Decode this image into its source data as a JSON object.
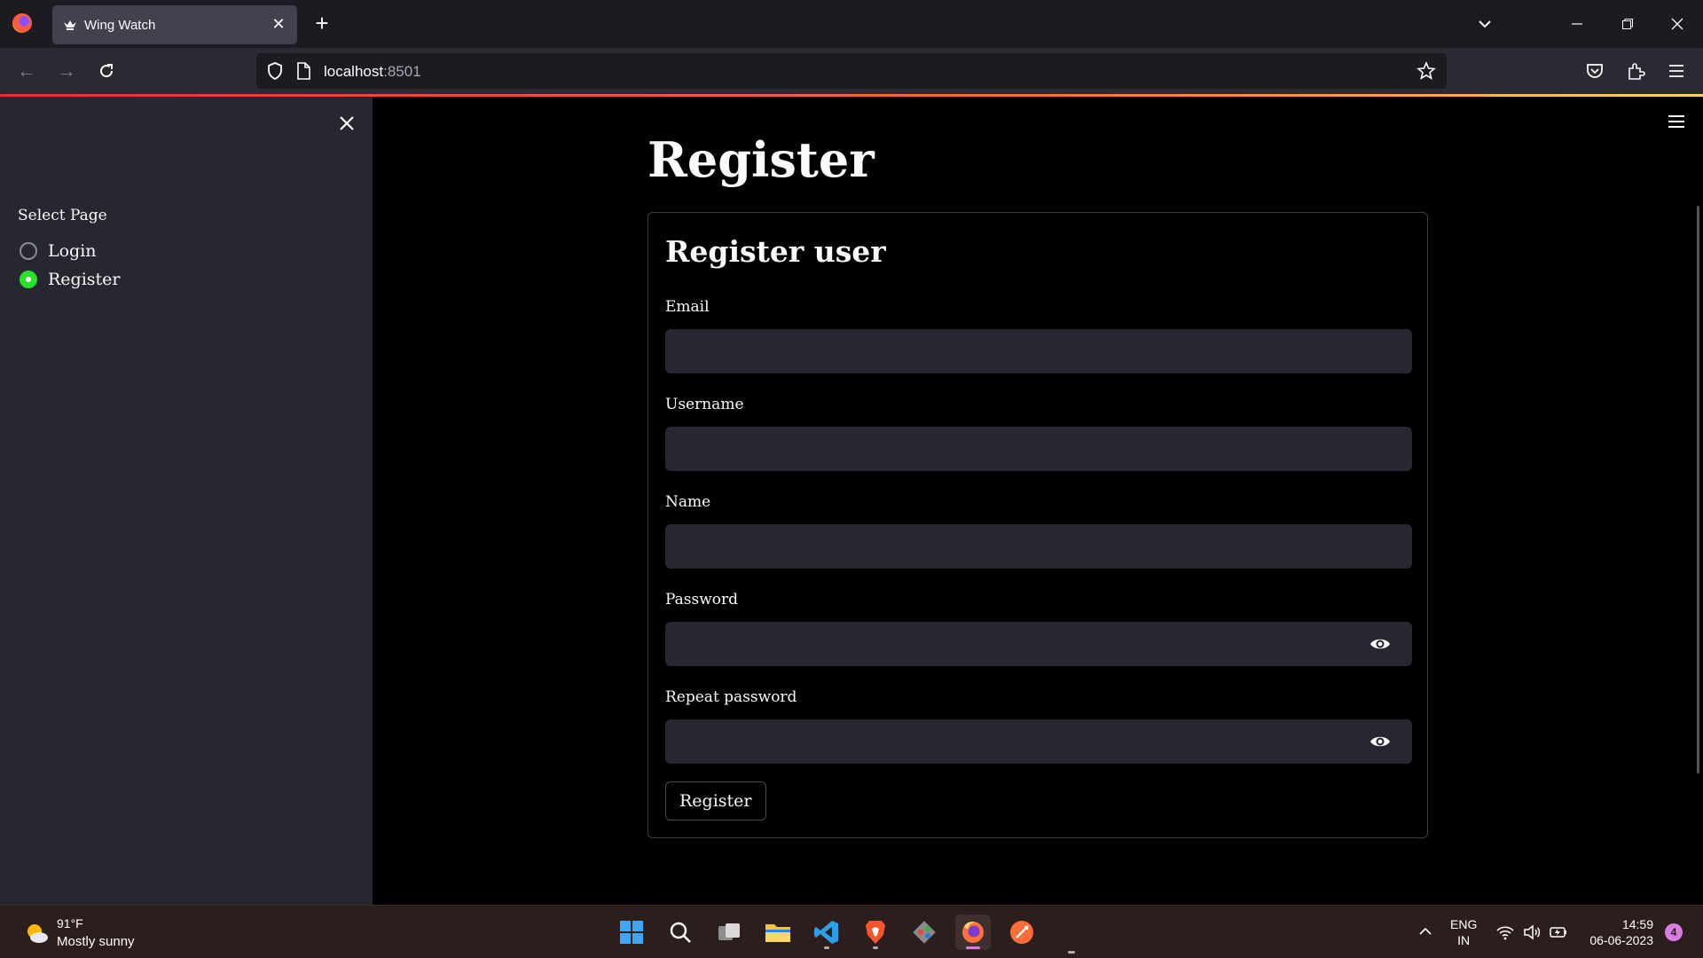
{
  "browser": {
    "tab_title": "Wing Watch",
    "url_host": "localhost",
    "url_port": ":8501"
  },
  "sidebar": {
    "select_label": "Select Page",
    "options": [
      {
        "label": "Login",
        "selected": false
      },
      {
        "label": "Register",
        "selected": true
      }
    ],
    "accent_color": "#2ae02a"
  },
  "main": {
    "page_title": "Register",
    "form": {
      "title": "Register user",
      "fields": [
        {
          "label": "Email",
          "value": ""
        },
        {
          "label": "Username",
          "value": ""
        },
        {
          "label": "Name",
          "value": ""
        },
        {
          "label": "Password",
          "value": ""
        },
        {
          "label": "Repeat password",
          "value": ""
        }
      ],
      "submit_label": "Register"
    }
  },
  "taskbar": {
    "weather_temp": "91°F",
    "weather_desc": "Mostly sunny",
    "lang_line1": "ENG",
    "lang_line2": "IN",
    "time": "14:59",
    "date": "06-06-2023",
    "notification_count": "4",
    "apps": [
      "start-icon",
      "search-icon",
      "task-view-icon",
      "file-explorer-icon",
      "vscode-icon",
      "brave-icon",
      "git-icon",
      "firefox-icon",
      "postman-icon"
    ]
  }
}
